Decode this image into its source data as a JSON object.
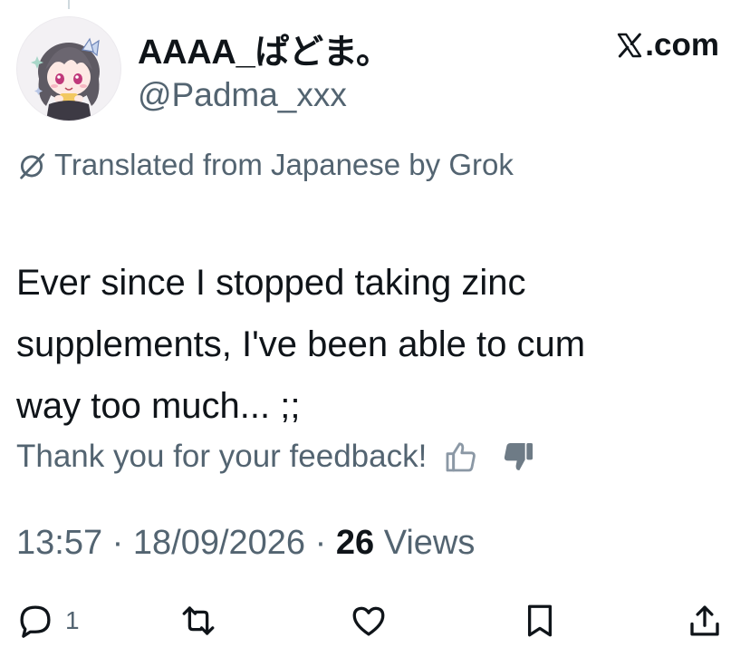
{
  "header": {
    "display_name": "AAAA_ぱどま。",
    "handle": "@Padma_xxx",
    "source": ".com",
    "avatar_icon": "anime-avatar-icon"
  },
  "translation": {
    "label": "Translated from Japanese by Grok",
    "icon": "globe-slash-icon"
  },
  "tweet": {
    "text": "Ever since I stopped taking zinc\nsupplements, I've been able to cum\nway too much... ;;"
  },
  "feedback": {
    "label": "Thank you for your feedback!",
    "thumbs_up_icon": "thumbs-up-outline-icon",
    "thumbs_down_icon": "thumbs-down-filled-icon"
  },
  "meta": {
    "time": "13:57",
    "date": "18/09/2026",
    "views_count": "26",
    "views_label": "Views"
  },
  "actions": {
    "reply_count": "1",
    "icons": [
      "reply-icon",
      "retweet-icon",
      "like-icon",
      "bookmark-icon",
      "share-icon"
    ]
  },
  "colors": {
    "text_primary": "#0f1419",
    "text_secondary": "#536471",
    "background": "#ffffff"
  }
}
